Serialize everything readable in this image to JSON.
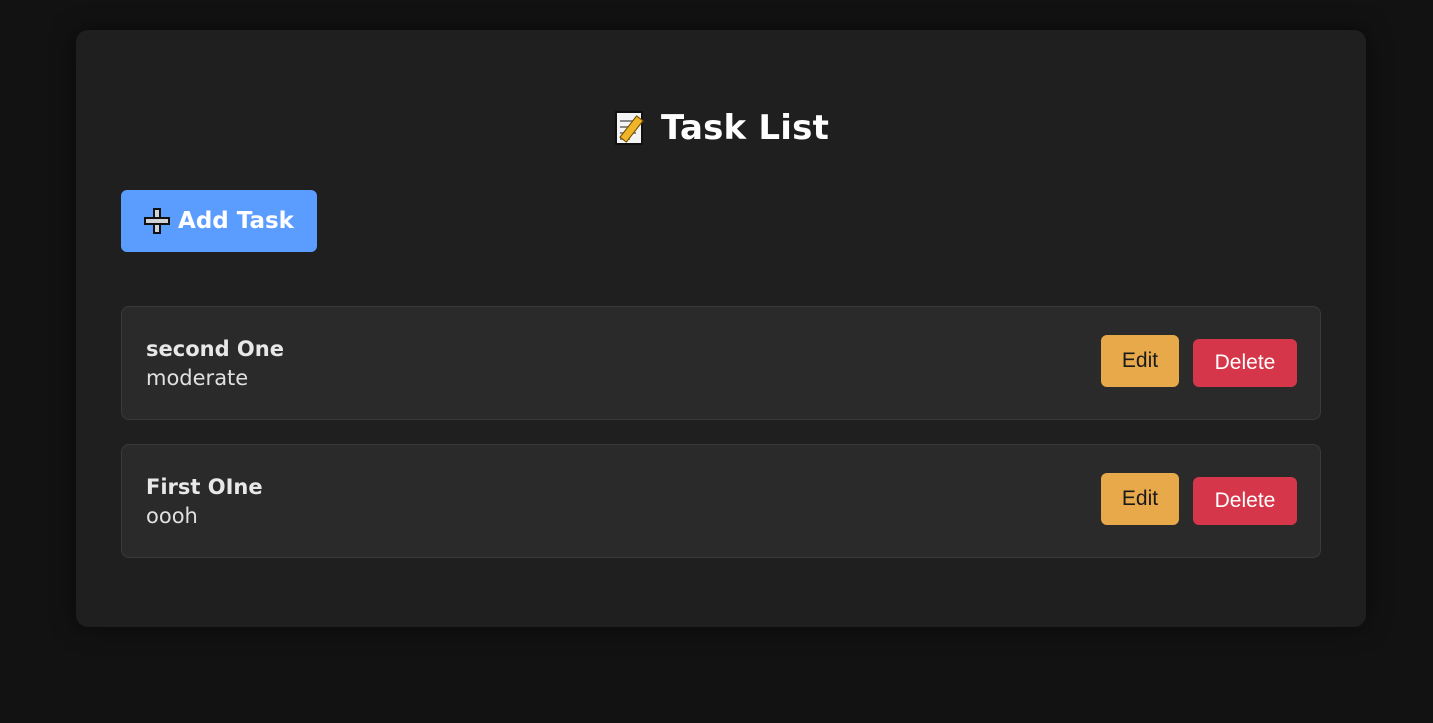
{
  "header": {
    "title": "Task List",
    "title_icon": "memo-icon"
  },
  "toolbar": {
    "add_label": "Add Task",
    "add_icon": "plus-icon",
    "add_color": "#5b9dff"
  },
  "tasks": [
    {
      "title": "second One",
      "description": "moderate",
      "edit_label": "Edit",
      "delete_label": "Delete"
    },
    {
      "title": "First OIne",
      "description": "oooh",
      "edit_label": "Edit",
      "delete_label": "Delete"
    }
  ],
  "colors": {
    "background": "#121212",
    "card": "#1f1f1f",
    "item": "#2a2a2a",
    "edit": "#e8a94a",
    "delete": "#d6364a"
  }
}
